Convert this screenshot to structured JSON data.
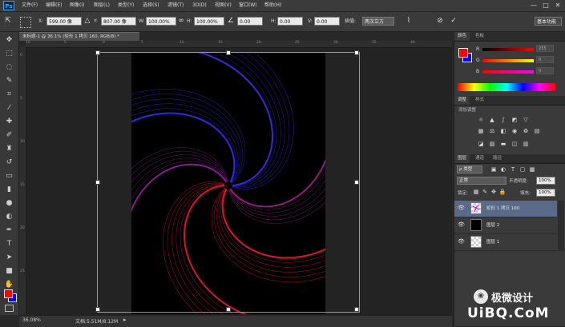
{
  "app": {
    "logo": "Ps"
  },
  "menu": [
    "文件(F)",
    "编辑(E)",
    "图像(I)",
    "图层(L)",
    "类型(Y)",
    "选择(S)",
    "滤镜(T)",
    "3D(D)",
    "视图(V)",
    "窗口(W)",
    "帮助(H)"
  ],
  "window_controls": {
    "minimize": "—",
    "maximize": "□",
    "close": "✕"
  },
  "options": {
    "x_label": "X:",
    "x_value": "599.00 像",
    "y_label": "Y:",
    "y_value": "807.00 像",
    "w_label": "W:",
    "w_value": "100.00%",
    "h_label": "H:",
    "h_value": "100.00%",
    "angle_value": "0.00",
    "hskew_label": "H:",
    "hskew_value": "0.00",
    "vskew_label": "V:",
    "vskew_value": "0.00",
    "interp_label": "插值:",
    "interp_value": "两次立方",
    "workspace": "基本功能"
  },
  "document": {
    "tab_title": "未标题-1 @ 36.1% (矩形 1 拷贝 160, RGB/8) *",
    "zoom": "36.08%",
    "doc_size": "文档:5.51M/8.12M"
  },
  "ruler": {
    "top": [
      "10",
      "5",
      "0",
      "5",
      "10",
      "15",
      "20",
      "25",
      "30",
      "35",
      "40"
    ],
    "left": [
      "0",
      "5",
      "10",
      "15",
      "20",
      "25"
    ]
  },
  "color_panel": {
    "tabs": [
      "颜色",
      "色板"
    ],
    "r_label": "R",
    "r_value": "255",
    "g_label": "G",
    "g_value": "0",
    "b_label": "B",
    "b_value": "0",
    "fg_color": "#ff0000",
    "bg_color": "#0000ff"
  },
  "adjust_panel": {
    "tabs": [
      "调整",
      "样式"
    ],
    "title": "添加调整"
  },
  "layers_panel": {
    "tabs": [
      "图层",
      "通道",
      "路径"
    ],
    "kind_label": "ρ 类型",
    "blend_mode": "正常",
    "opacity_label": "不透明度:",
    "opacity_value": "100%",
    "lock_label": "锁定:",
    "fill_label": "填充:",
    "fill_value": "100%",
    "layers": [
      {
        "name": "矩形 1 拷贝 160",
        "selected": true
      },
      {
        "name": "图层 2",
        "selected": false
      },
      {
        "name": "图层 1",
        "selected": false
      }
    ]
  },
  "watermark": {
    "text": "极微设计",
    "brand": "UiBQ.CoM"
  },
  "colors": {
    "accent": "#31a8ff",
    "selected_layer": "#596b88",
    "spiral_red": "#ff1020",
    "spiral_blue": "#2a2aff"
  }
}
